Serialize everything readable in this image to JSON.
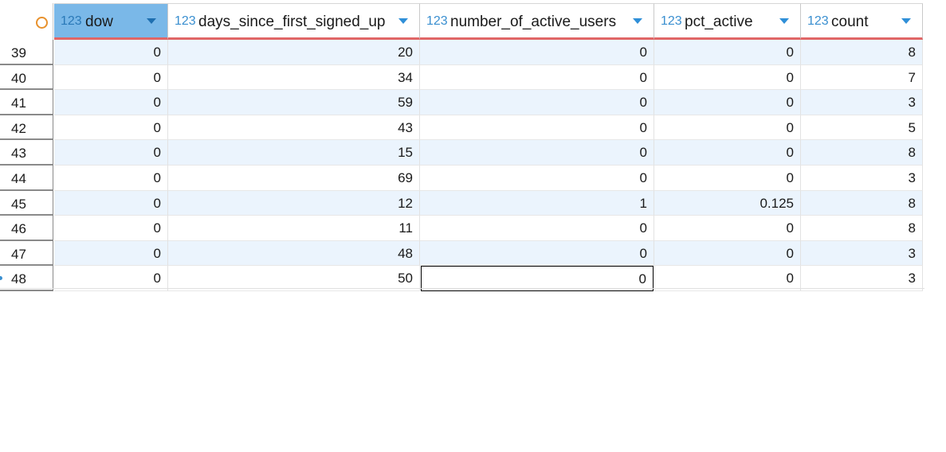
{
  "columns": [
    {
      "type_icon": "123",
      "name": "dow"
    },
    {
      "type_icon": "123",
      "name": "days_since_first_signed_up"
    },
    {
      "type_icon": "123",
      "name": "number_of_active_users"
    },
    {
      "type_icon": "123",
      "name": "pct_active"
    },
    {
      "type_icon": "123",
      "name": "count"
    }
  ],
  "rows": [
    {
      "rownum": "39",
      "cells": [
        "0",
        "20",
        "0",
        "0",
        "8"
      ]
    },
    {
      "rownum": "40",
      "cells": [
        "0",
        "34",
        "0",
        "0",
        "7"
      ]
    },
    {
      "rownum": "41",
      "cells": [
        "0",
        "59",
        "0",
        "0",
        "3"
      ]
    },
    {
      "rownum": "42",
      "cells": [
        "0",
        "43",
        "0",
        "0",
        "5"
      ]
    },
    {
      "rownum": "43",
      "cells": [
        "0",
        "15",
        "0",
        "0",
        "8"
      ]
    },
    {
      "rownum": "44",
      "cells": [
        "0",
        "69",
        "0",
        "0",
        "3"
      ]
    },
    {
      "rownum": "45",
      "cells": [
        "0",
        "12",
        "1",
        "0.125",
        "8"
      ]
    },
    {
      "rownum": "46",
      "cells": [
        "0",
        "11",
        "0",
        "0",
        "8"
      ]
    },
    {
      "rownum": "47",
      "cells": [
        "0",
        "48",
        "0",
        "0",
        "3"
      ]
    },
    {
      "rownum": "48",
      "cells": [
        "0",
        "50",
        "0",
        "0",
        "3"
      ]
    }
  ],
  "selected_column": "dow",
  "focused_cell": {
    "row": "48",
    "column": "number_of_active_users"
  },
  "colors": {
    "accent": "#7ab8e8",
    "row_alt": "#ebf4fd",
    "header_underline": "#e06666",
    "type_icon": "#3a8fd0",
    "corner_ring": "#e8912c"
  }
}
